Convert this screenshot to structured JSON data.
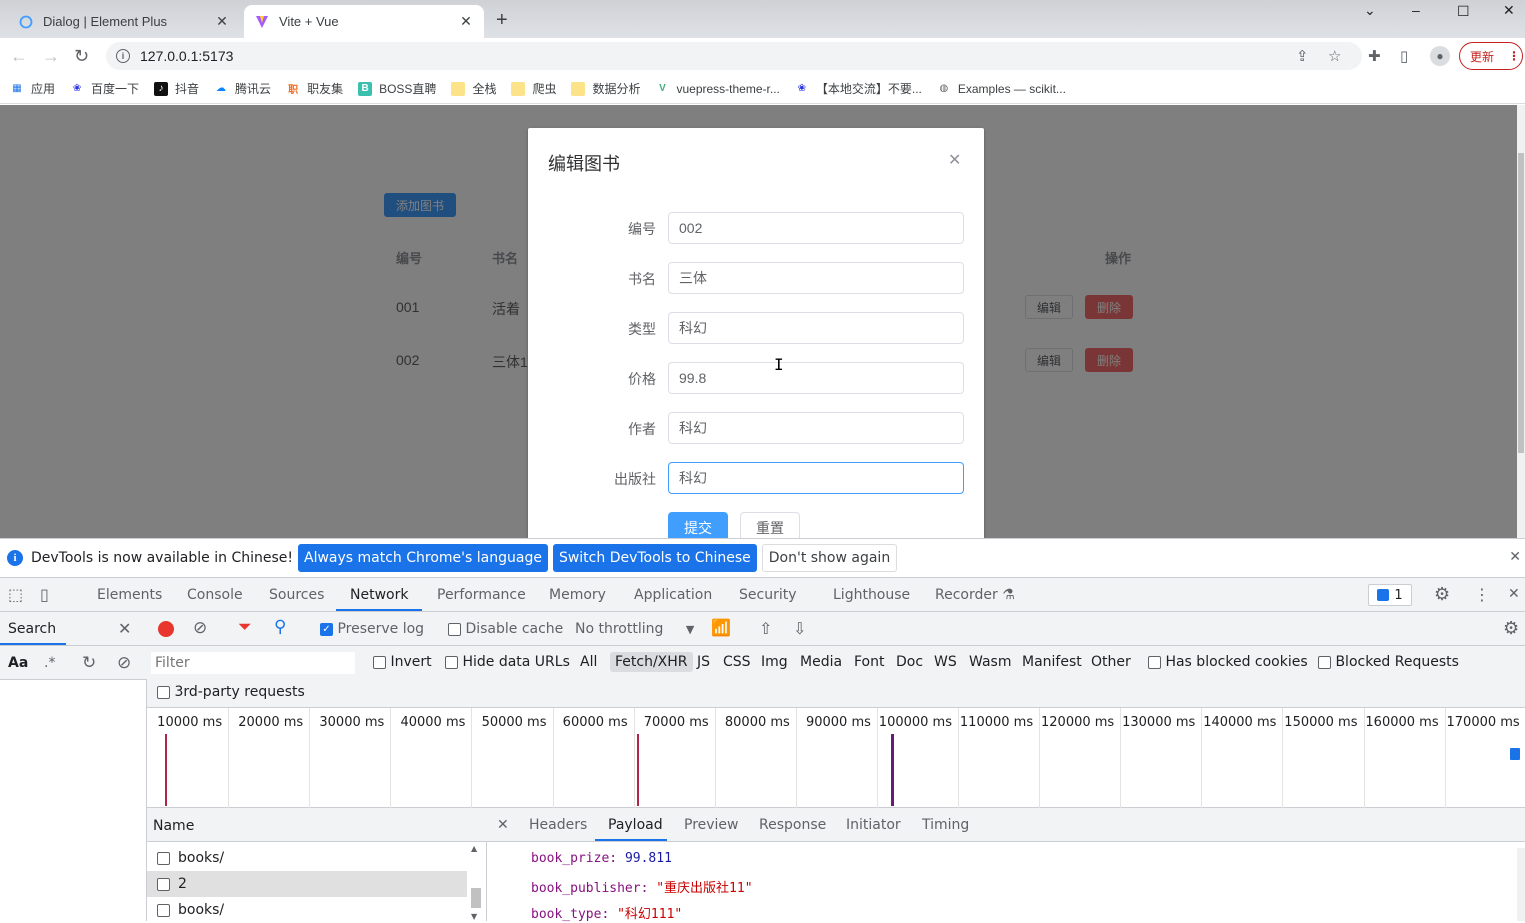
{
  "browser": {
    "tabs": [
      {
        "title": "Dialog | Element Plus",
        "icon": "element-plus-icon",
        "active": false
      },
      {
        "title": "Vite + Vue",
        "icon": "vite-icon",
        "active": true
      }
    ],
    "new_tab_label": "+",
    "url": "127.0.0.1:5173",
    "update_label": "更新",
    "bookmarks": [
      {
        "label": "应用",
        "icon": "apps-grid-icon"
      },
      {
        "label": "百度一下",
        "icon": "baidu-paw-icon"
      },
      {
        "label": "抖音",
        "icon": "douyin-icon"
      },
      {
        "label": "腾讯云",
        "icon": "tencent-cloud-icon"
      },
      {
        "label": "职友集",
        "icon": "jobui-icon"
      },
      {
        "label": "BOSS直聘",
        "icon": "boss-icon"
      },
      {
        "label": "全栈",
        "icon": "folder-icon"
      },
      {
        "label": "爬虫",
        "icon": "folder-icon"
      },
      {
        "label": "数据分析",
        "icon": "folder-icon"
      },
      {
        "label": "vuepress-theme-r...",
        "icon": "vuepress-icon"
      },
      {
        "label": "【本地交流】不要...",
        "icon": "baidu-paw-icon"
      },
      {
        "label": "Examples — scikit...",
        "icon": "globe-icon"
      }
    ]
  },
  "app": {
    "add_button": "添加图书",
    "table": {
      "headers": [
        "编号",
        "书名",
        "操作"
      ],
      "rows": [
        {
          "id": "001",
          "name": "活着",
          "edit": "编辑",
          "delete": "删除"
        },
        {
          "id": "002",
          "name": "三体1",
          "edit": "编辑",
          "delete": "删除"
        }
      ]
    },
    "dialog": {
      "title": "编辑图书",
      "fields": [
        {
          "label": "编号",
          "value": "002"
        },
        {
          "label": "书名",
          "value": "三体"
        },
        {
          "label": "类型",
          "value": "科幻"
        },
        {
          "label": "价格",
          "value": "99.8"
        },
        {
          "label": "作者",
          "value": "科幻"
        },
        {
          "label": "出版社",
          "value": "科幻"
        }
      ],
      "submit": "提交",
      "reset": "重置"
    }
  },
  "devtools": {
    "infobar": {
      "message": "DevTools is now available in Chinese!",
      "btn_match": "Always match Chrome's language",
      "btn_switch": "Switch DevTools to Chinese",
      "btn_dismiss": "Don't show again"
    },
    "tabs": [
      "Elements",
      "Console",
      "Sources",
      "Network",
      "Performance",
      "Memory",
      "Application",
      "Security",
      "Lighthouse",
      "Recorder"
    ],
    "active_tab": "Network",
    "issues_count": "1",
    "search": {
      "label": "Search",
      "case_label": "Aa",
      "regex_label": ".*"
    },
    "network": {
      "preserve_log": {
        "label": "Preserve log",
        "checked": true
      },
      "disable_cache": {
        "label": "Disable cache",
        "checked": false
      },
      "throttling": "No throttling",
      "filter_placeholder": "Filter",
      "invert": "Invert",
      "hide_data_urls": "Hide data URLs",
      "types": [
        "All",
        "Fetch/XHR",
        "JS",
        "CSS",
        "Img",
        "Media",
        "Font",
        "Doc",
        "WS",
        "Wasm",
        "Manifest",
        "Other"
      ],
      "selected_type": "Fetch/XHR",
      "has_blocked_cookies": "Has blocked cookies",
      "blocked_requests": "Blocked Requests",
      "third_party": "3rd-party requests",
      "timeline_ticks": [
        "10000 ms",
        "20000 ms",
        "30000 ms",
        "40000 ms",
        "50000 ms",
        "60000 ms",
        "70000 ms",
        "80000 ms",
        "90000 ms",
        "100000 ms",
        "110000 ms",
        "120000 ms",
        "130000 ms",
        "140000 ms",
        "150000 ms",
        "160000 ms",
        "170000 ms"
      ],
      "name_header": "Name",
      "requests": [
        {
          "name": "books/",
          "selected": false
        },
        {
          "name": "2",
          "selected": true
        },
        {
          "name": "books/",
          "selected": false
        }
      ],
      "detail_tabs": [
        "Headers",
        "Payload",
        "Preview",
        "Response",
        "Initiator",
        "Timing"
      ],
      "active_detail_tab": "Payload",
      "payload": [
        {
          "key": "book_prize",
          "value": "99.811",
          "type": "number"
        },
        {
          "key": "book_publisher",
          "value": "\"重庆出版社11\"",
          "type": "string"
        },
        {
          "key": "book_type",
          "value": "\"科幻111\"",
          "type": "string"
        }
      ]
    }
  }
}
